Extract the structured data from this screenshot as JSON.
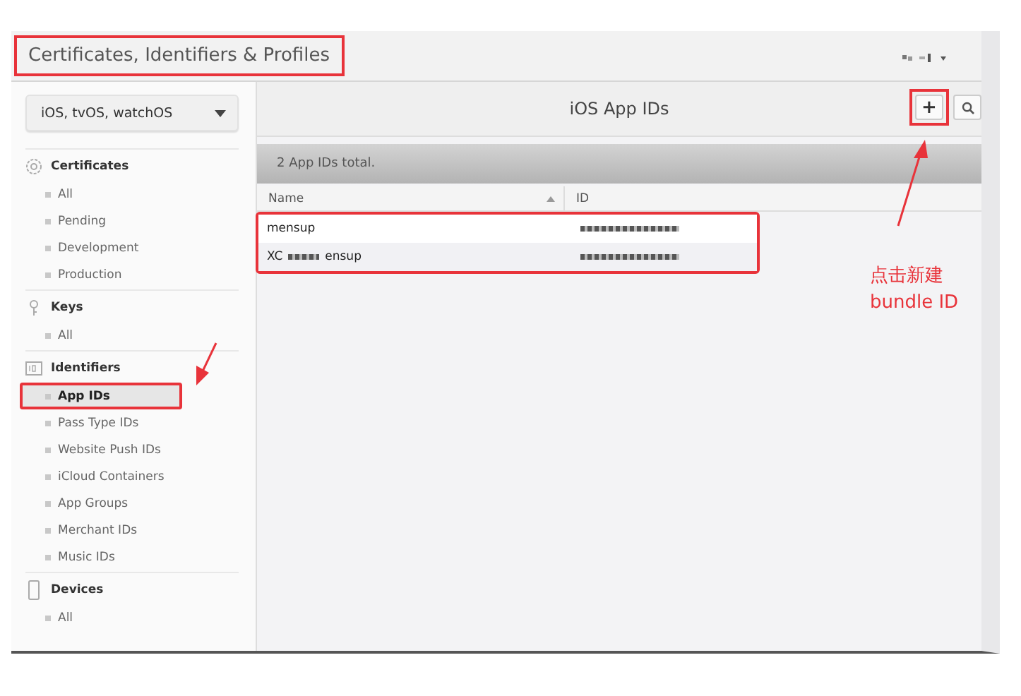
{
  "header": {
    "title": "Certificates, Identifiers & Profiles",
    "title_highlighted": true
  },
  "platform_dropdown": {
    "value": "iOS, tvOS, watchOS"
  },
  "sidebar": {
    "sections": [
      {
        "kind": "certificates",
        "title": "Certificates",
        "items": [
          {
            "label": "All",
            "selected": false,
            "highlighted": false
          },
          {
            "label": "Pending",
            "selected": false,
            "highlighted": false
          },
          {
            "label": "Development",
            "selected": false,
            "highlighted": false
          },
          {
            "label": "Production",
            "selected": false,
            "highlighted": false
          }
        ]
      },
      {
        "kind": "keys",
        "title": "Keys",
        "items": [
          {
            "label": "All",
            "selected": false,
            "highlighted": false
          }
        ]
      },
      {
        "kind": "identifiers",
        "title": "Identifiers",
        "items": [
          {
            "label": "App IDs",
            "selected": true,
            "highlighted": true
          },
          {
            "label": "Pass Type IDs",
            "selected": false,
            "highlighted": false
          },
          {
            "label": "Website Push IDs",
            "selected": false,
            "highlighted": false
          },
          {
            "label": "iCloud Containers",
            "selected": false,
            "highlighted": false
          },
          {
            "label": "App Groups",
            "selected": false,
            "highlighted": false
          },
          {
            "label": "Merchant IDs",
            "selected": false,
            "highlighted": false
          },
          {
            "label": "Music IDs",
            "selected": false,
            "highlighted": false
          }
        ]
      },
      {
        "kind": "devices",
        "title": "Devices",
        "items": [
          {
            "label": "All",
            "selected": false,
            "highlighted": false
          }
        ]
      }
    ]
  },
  "content": {
    "title": "iOS App IDs",
    "add_button": {
      "label": "+",
      "highlighted": true
    },
    "summary": "2  App IDs total.",
    "table": {
      "columns": [
        "Name",
        "ID"
      ],
      "rows_highlighted": true,
      "rows": [
        {
          "name": "mensup",
          "name_redacted": false,
          "name_suffix": ""
        },
        {
          "name": "XC",
          "name_redacted": true,
          "name_suffix": "ensup"
        }
      ]
    }
  },
  "annotation": {
    "callout": [
      "点击新建",
      "bundle ID"
    ]
  }
}
